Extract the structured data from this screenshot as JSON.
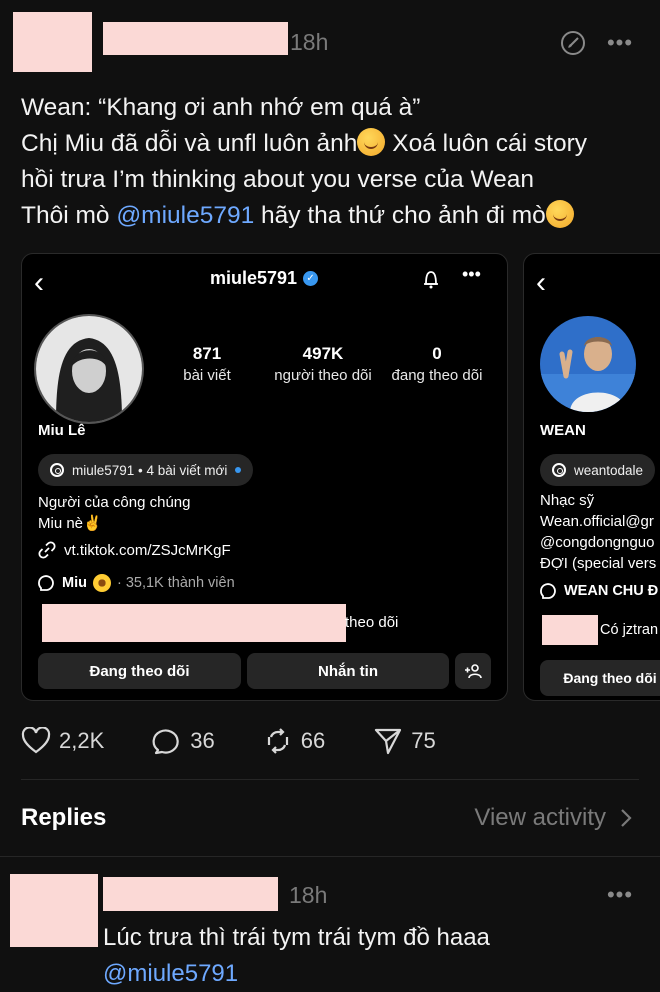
{
  "post": {
    "time": "18h",
    "lines": [
      {
        "text": "Wean: “Khang ơi anh nhớ em quá à”"
      },
      {
        "text": "Chị Miu đã dỗi và unfl luôn ảnh",
        "after_emoji": " Xoá luôn cái story"
      },
      {
        "text": "hồi trưa I’m thinking about you verse của Wean"
      },
      {
        "prefix": "Thôi mò ",
        "mention": "@miule5791",
        "text": " hãy tha thứ cho ảnh đi mò"
      }
    ],
    "icons": {
      "edit": "edit-icon",
      "more": "more-icon",
      "emoji_relieved": "relieved-face-emoji",
      "emoji_wink": "winking-face-emoji"
    }
  },
  "card1": {
    "handle": "miule5791",
    "stats": [
      {
        "num": "871",
        "label": "bài viết"
      },
      {
        "num": "497K",
        "label": "người theo dõi"
      },
      {
        "num": "0",
        "label": "đang theo dõi"
      }
    ],
    "name": "Miu Lê",
    "threads_pill": "miule5791 • 4 bài viết mới",
    "bio": [
      "Người của công chúng",
      "Miu nè✌️"
    ],
    "link": "vt.tiktok.com/ZSJcMrKgF",
    "channel_name": "Miu",
    "channel_members": "· 35,1K thành viên",
    "followed_by_suffix": "theo dõi",
    "btn_following": "Đang theo dõi",
    "btn_message": "Nhắn tin",
    "btn_add": "+"
  },
  "card2": {
    "name": "WEAN",
    "threads_pill": "weantodale",
    "bio": [
      "Nhạc sỹ",
      "Wean.official@gr",
      "@congdongnguo",
      "ĐỢI (special vers"
    ],
    "channel": "WEAN CHU Đ",
    "followed_by": "Có jztran",
    "btn_following": "Đang theo dõi"
  },
  "actions": {
    "likes": "2,2K",
    "comments": "36",
    "reposts": "66",
    "shares": "75"
  },
  "replies": {
    "title": "Replies",
    "view_activity": "View activity"
  },
  "reply": {
    "time": "18h",
    "text": "Lúc trưa thì trái tym trái tym đồ haaa",
    "mention": "@miule5791"
  }
}
